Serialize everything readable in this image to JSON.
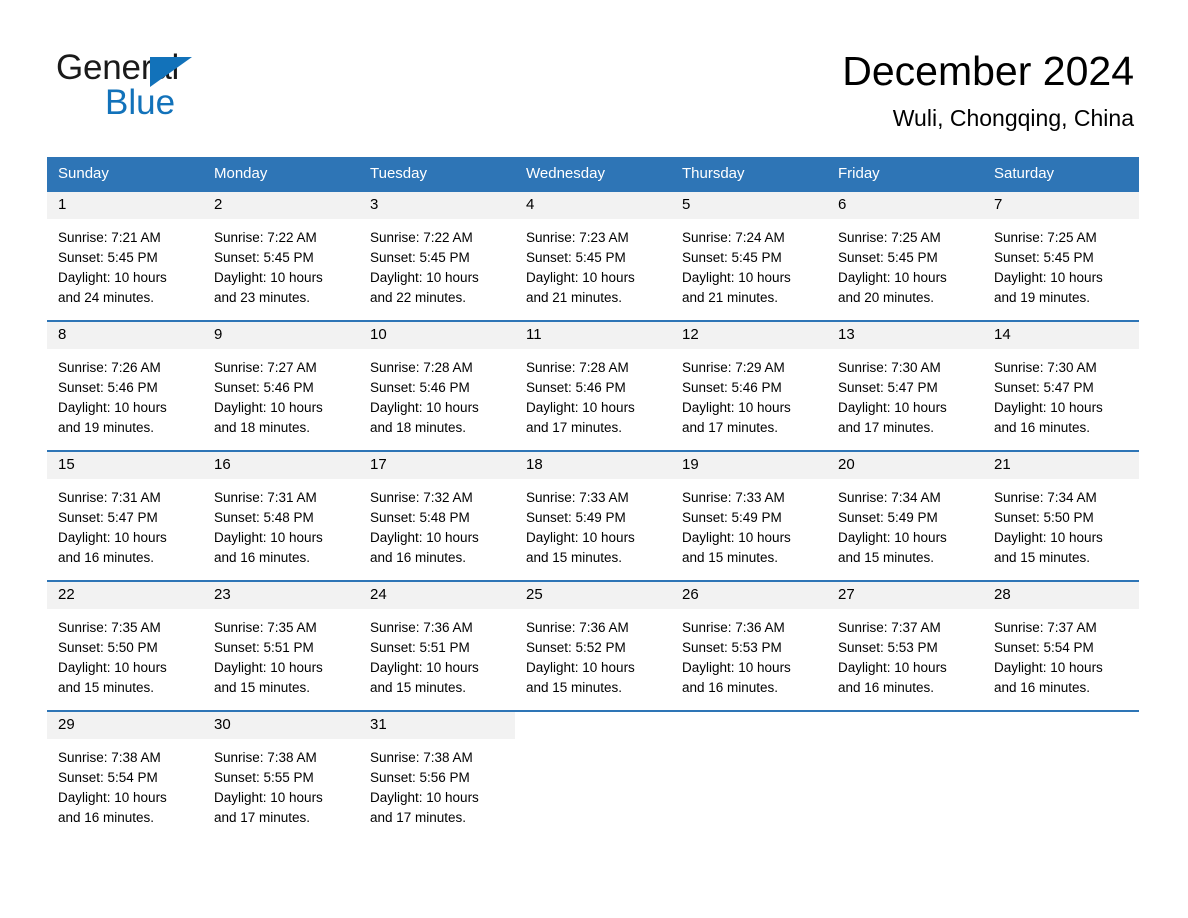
{
  "brand": {
    "name_part1": "General",
    "name_part2": "Blue",
    "triangle_color": "#1272ba"
  },
  "header": {
    "title": "December 2024",
    "subtitle": "Wuli, Chongqing, China"
  },
  "theme": {
    "header_blue": "#2e75b6",
    "daynum_strip": "#f2f2f2",
    "brand_blue": "#1272ba"
  },
  "weekdays": [
    "Sunday",
    "Monday",
    "Tuesday",
    "Wednesday",
    "Thursday",
    "Friday",
    "Saturday"
  ],
  "weeks": [
    [
      {
        "day": "1",
        "sunrise": "Sunrise: 7:21 AM",
        "sunset": "Sunset: 5:45 PM",
        "daylight1": "Daylight: 10 hours",
        "daylight2": "and 24 minutes."
      },
      {
        "day": "2",
        "sunrise": "Sunrise: 7:22 AM",
        "sunset": "Sunset: 5:45 PM",
        "daylight1": "Daylight: 10 hours",
        "daylight2": "and 23 minutes."
      },
      {
        "day": "3",
        "sunrise": "Sunrise: 7:22 AM",
        "sunset": "Sunset: 5:45 PM",
        "daylight1": "Daylight: 10 hours",
        "daylight2": "and 22 minutes."
      },
      {
        "day": "4",
        "sunrise": "Sunrise: 7:23 AM",
        "sunset": "Sunset: 5:45 PM",
        "daylight1": "Daylight: 10 hours",
        "daylight2": "and 21 minutes."
      },
      {
        "day": "5",
        "sunrise": "Sunrise: 7:24 AM",
        "sunset": "Sunset: 5:45 PM",
        "daylight1": "Daylight: 10 hours",
        "daylight2": "and 21 minutes."
      },
      {
        "day": "6",
        "sunrise": "Sunrise: 7:25 AM",
        "sunset": "Sunset: 5:45 PM",
        "daylight1": "Daylight: 10 hours",
        "daylight2": "and 20 minutes."
      },
      {
        "day": "7",
        "sunrise": "Sunrise: 7:25 AM",
        "sunset": "Sunset: 5:45 PM",
        "daylight1": "Daylight: 10 hours",
        "daylight2": "and 19 minutes."
      }
    ],
    [
      {
        "day": "8",
        "sunrise": "Sunrise: 7:26 AM",
        "sunset": "Sunset: 5:46 PM",
        "daylight1": "Daylight: 10 hours",
        "daylight2": "and 19 minutes."
      },
      {
        "day": "9",
        "sunrise": "Sunrise: 7:27 AM",
        "sunset": "Sunset: 5:46 PM",
        "daylight1": "Daylight: 10 hours",
        "daylight2": "and 18 minutes."
      },
      {
        "day": "10",
        "sunrise": "Sunrise: 7:28 AM",
        "sunset": "Sunset: 5:46 PM",
        "daylight1": "Daylight: 10 hours",
        "daylight2": "and 18 minutes."
      },
      {
        "day": "11",
        "sunrise": "Sunrise: 7:28 AM",
        "sunset": "Sunset: 5:46 PM",
        "daylight1": "Daylight: 10 hours",
        "daylight2": "and 17 minutes."
      },
      {
        "day": "12",
        "sunrise": "Sunrise: 7:29 AM",
        "sunset": "Sunset: 5:46 PM",
        "daylight1": "Daylight: 10 hours",
        "daylight2": "and 17 minutes."
      },
      {
        "day": "13",
        "sunrise": "Sunrise: 7:30 AM",
        "sunset": "Sunset: 5:47 PM",
        "daylight1": "Daylight: 10 hours",
        "daylight2": "and 17 minutes."
      },
      {
        "day": "14",
        "sunrise": "Sunrise: 7:30 AM",
        "sunset": "Sunset: 5:47 PM",
        "daylight1": "Daylight: 10 hours",
        "daylight2": "and 16 minutes."
      }
    ],
    [
      {
        "day": "15",
        "sunrise": "Sunrise: 7:31 AM",
        "sunset": "Sunset: 5:47 PM",
        "daylight1": "Daylight: 10 hours",
        "daylight2": "and 16 minutes."
      },
      {
        "day": "16",
        "sunrise": "Sunrise: 7:31 AM",
        "sunset": "Sunset: 5:48 PM",
        "daylight1": "Daylight: 10 hours",
        "daylight2": "and 16 minutes."
      },
      {
        "day": "17",
        "sunrise": "Sunrise: 7:32 AM",
        "sunset": "Sunset: 5:48 PM",
        "daylight1": "Daylight: 10 hours",
        "daylight2": "and 16 minutes."
      },
      {
        "day": "18",
        "sunrise": "Sunrise: 7:33 AM",
        "sunset": "Sunset: 5:49 PM",
        "daylight1": "Daylight: 10 hours",
        "daylight2": "and 15 minutes."
      },
      {
        "day": "19",
        "sunrise": "Sunrise: 7:33 AM",
        "sunset": "Sunset: 5:49 PM",
        "daylight1": "Daylight: 10 hours",
        "daylight2": "and 15 minutes."
      },
      {
        "day": "20",
        "sunrise": "Sunrise: 7:34 AM",
        "sunset": "Sunset: 5:49 PM",
        "daylight1": "Daylight: 10 hours",
        "daylight2": "and 15 minutes."
      },
      {
        "day": "21",
        "sunrise": "Sunrise: 7:34 AM",
        "sunset": "Sunset: 5:50 PM",
        "daylight1": "Daylight: 10 hours",
        "daylight2": "and 15 minutes."
      }
    ],
    [
      {
        "day": "22",
        "sunrise": "Sunrise: 7:35 AM",
        "sunset": "Sunset: 5:50 PM",
        "daylight1": "Daylight: 10 hours",
        "daylight2": "and 15 minutes."
      },
      {
        "day": "23",
        "sunrise": "Sunrise: 7:35 AM",
        "sunset": "Sunset: 5:51 PM",
        "daylight1": "Daylight: 10 hours",
        "daylight2": "and 15 minutes."
      },
      {
        "day": "24",
        "sunrise": "Sunrise: 7:36 AM",
        "sunset": "Sunset: 5:51 PM",
        "daylight1": "Daylight: 10 hours",
        "daylight2": "and 15 minutes."
      },
      {
        "day": "25",
        "sunrise": "Sunrise: 7:36 AM",
        "sunset": "Sunset: 5:52 PM",
        "daylight1": "Daylight: 10 hours",
        "daylight2": "and 15 minutes."
      },
      {
        "day": "26",
        "sunrise": "Sunrise: 7:36 AM",
        "sunset": "Sunset: 5:53 PM",
        "daylight1": "Daylight: 10 hours",
        "daylight2": "and 16 minutes."
      },
      {
        "day": "27",
        "sunrise": "Sunrise: 7:37 AM",
        "sunset": "Sunset: 5:53 PM",
        "daylight1": "Daylight: 10 hours",
        "daylight2": "and 16 minutes."
      },
      {
        "day": "28",
        "sunrise": "Sunrise: 7:37 AM",
        "sunset": "Sunset: 5:54 PM",
        "daylight1": "Daylight: 10 hours",
        "daylight2": "and 16 minutes."
      }
    ],
    [
      {
        "day": "29",
        "sunrise": "Sunrise: 7:38 AM",
        "sunset": "Sunset: 5:54 PM",
        "daylight1": "Daylight: 10 hours",
        "daylight2": "and 16 minutes."
      },
      {
        "day": "30",
        "sunrise": "Sunrise: 7:38 AM",
        "sunset": "Sunset: 5:55 PM",
        "daylight1": "Daylight: 10 hours",
        "daylight2": "and 17 minutes."
      },
      {
        "day": "31",
        "sunrise": "Sunrise: 7:38 AM",
        "sunset": "Sunset: 5:56 PM",
        "daylight1": "Daylight: 10 hours",
        "daylight2": "and 17 minutes."
      },
      {
        "day": "",
        "sunrise": "",
        "sunset": "",
        "daylight1": "",
        "daylight2": ""
      },
      {
        "day": "",
        "sunrise": "",
        "sunset": "",
        "daylight1": "",
        "daylight2": ""
      },
      {
        "day": "",
        "sunrise": "",
        "sunset": "",
        "daylight1": "",
        "daylight2": ""
      },
      {
        "day": "",
        "sunrise": "",
        "sunset": "",
        "daylight1": "",
        "daylight2": ""
      }
    ]
  ]
}
